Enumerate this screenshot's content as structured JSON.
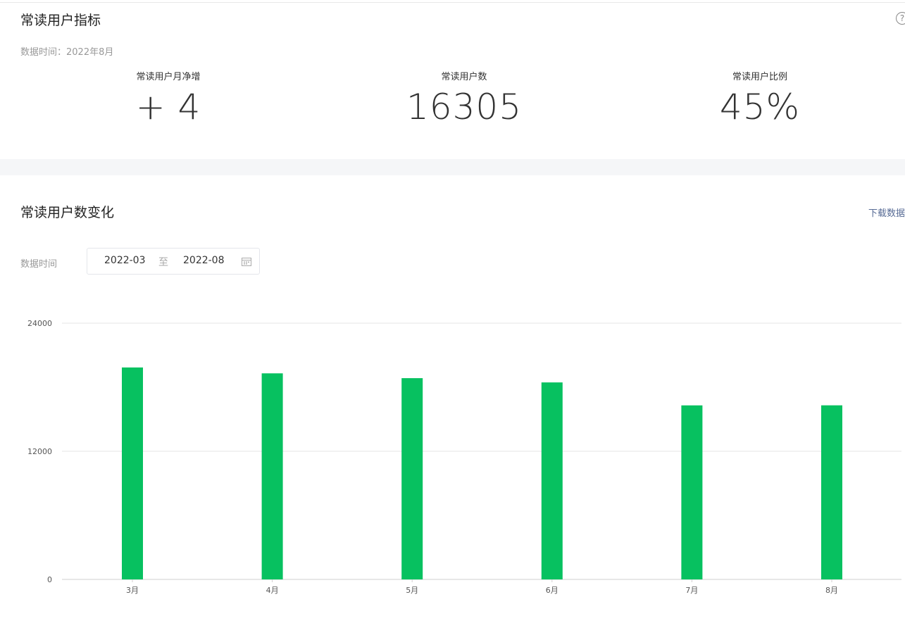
{
  "metrics_section": {
    "title": "常读用户指标",
    "help_symbol": "?",
    "data_time_label": "数据时间：",
    "data_time_value": "2022年8月",
    "items": [
      {
        "label": "常读用户月净增",
        "value": "+ 4"
      },
      {
        "label": "常读用户数",
        "value": "16305"
      },
      {
        "label": "常读用户比例",
        "value": "45%"
      }
    ]
  },
  "chart_section": {
    "title": "常读用户数变化",
    "download_label": "下载数据",
    "range_label": "数据时间",
    "range_start": "2022-03",
    "range_separator": "至",
    "range_end": "2022-08",
    "calendar_icon": "calendar-icon"
  },
  "colors": {
    "bar": "#07c160",
    "gridline": "#e6e6e6",
    "link": "#576b95"
  },
  "chart_data": {
    "type": "bar",
    "categories": [
      "3月",
      "4月",
      "5月",
      "6月",
      "7月",
      "8月"
    ],
    "values": [
      19850,
      19300,
      18850,
      18450,
      16300,
      16305
    ],
    "ylim": [
      0,
      24000
    ],
    "yticks": [
      0,
      12000,
      24000
    ],
    "grid": true,
    "title": "",
    "xlabel": "",
    "ylabel": ""
  }
}
